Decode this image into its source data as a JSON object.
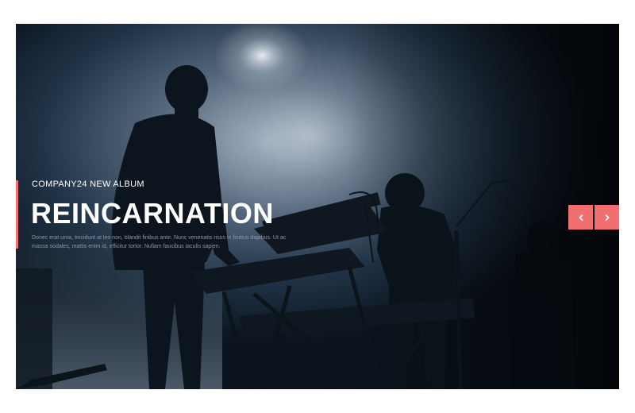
{
  "slider": {
    "eyebrow": "COMPANY24 NEW ALBUM",
    "title": "REINCARNATION",
    "description": "Donec erat urna, tincidunt at leo non, blandit finibus ante. Nunc venenatis risus in finibus dapibus. Ut ac massa sodales, mattis enim id, efficitur tortor. Nullam faucibus iaculis sapien.",
    "accent_color": "#f26f6f",
    "prev_icon": "chevron-left-icon",
    "next_icon": "chevron-right-icon"
  }
}
